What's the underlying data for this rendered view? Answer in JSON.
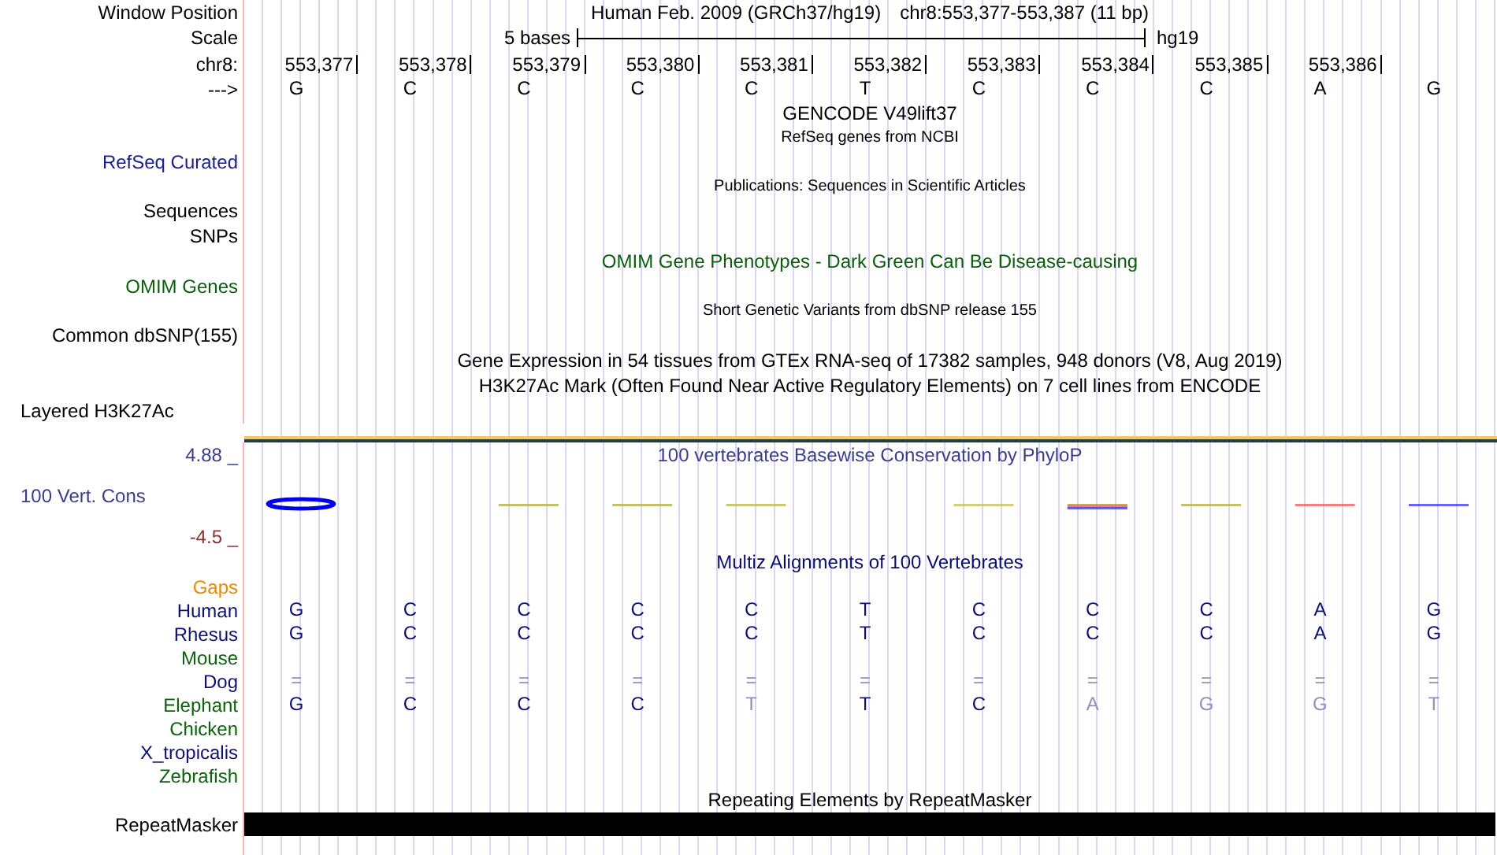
{
  "header": {
    "position_label": "Window Position",
    "assembly_title": "Human Feb. 2009 (GRCh37/hg19)",
    "range_title": "chr8:553,377-553,387 (11 bp)",
    "scale_label": "Scale",
    "scale_text": "5 bases",
    "scale_db": "hg19",
    "chrom_label": "chr8:",
    "positions": [
      "553,377",
      "553,378",
      "553,379",
      "553,380",
      "553,381",
      "553,382",
      "553,383",
      "553,384",
      "553,385",
      "553,386"
    ],
    "strand_label": "--->",
    "bases": [
      "G",
      "C",
      "C",
      "C",
      "C",
      "T",
      "C",
      "C",
      "C",
      "A",
      "G"
    ]
  },
  "tracks": [
    {
      "kind": "title",
      "text": "GENCODE V49lift37",
      "color": "#000000"
    },
    {
      "kind": "subtitle",
      "text": "RefSeq genes from NCBI"
    },
    {
      "kind": "label",
      "label": "RefSeq Curated",
      "color": "#1c1c8c"
    },
    {
      "kind": "subtitle",
      "text": "Publications: Sequences in Scientific Articles"
    },
    {
      "kind": "label",
      "label": "Sequences",
      "color": "#000000"
    },
    {
      "kind": "label",
      "label": "SNPs",
      "color": "#000000"
    },
    {
      "kind": "title",
      "text": "OMIM Gene Phenotypes - Dark Green Can Be Disease-causing",
      "color": "#0b5e0b"
    },
    {
      "kind": "label",
      "label": "OMIM Genes",
      "color": "#0b5e0b"
    },
    {
      "kind": "subtitle",
      "text": "Short Genetic Variants from dbSNP release 155"
    },
    {
      "kind": "label",
      "label": "Common dbSNP(155)",
      "color": "#000000"
    },
    {
      "kind": "title",
      "text": "Gene Expression in 54 tissues from GTEx RNA-seq of 17382 samples, 948 donors (V8, Aug 2019)",
      "color": "#000000"
    },
    {
      "kind": "title",
      "text": "H3K27Ac Mark (Often Found Near Active Regulatory Elements) on 7 cell lines from ENCODE",
      "color": "#000000"
    },
    {
      "kind": "leftlabel",
      "label": "Layered H3K27Ac",
      "color": "#000000"
    },
    {
      "kind": "wiggle",
      "label": "100 Vert. Cons",
      "max": "4.88 _",
      "min": "-4.5 _",
      "text": "100 vertebrates Basewise Conservation by PhyloP",
      "color": "#3c3c8c"
    },
    {
      "kind": "title",
      "text": "Multiz Alignments of 100 Vertebrates",
      "color": "#0c0c6c"
    },
    {
      "kind": "species",
      "label": "Gaps",
      "color": "#e68a00"
    },
    {
      "kind": "species",
      "label": "Human",
      "color": "#101070",
      "bases": [
        {
          "base": "G",
          "match": true
        },
        {
          "base": "C",
          "match": true
        },
        {
          "base": "C",
          "match": true
        },
        {
          "base": "C",
          "match": true
        },
        {
          "base": "C",
          "match": true
        },
        {
          "base": "T",
          "match": true
        },
        {
          "base": "C",
          "match": true
        },
        {
          "base": "C",
          "match": true
        },
        {
          "base": "C",
          "match": true
        },
        {
          "base": "A",
          "match": true
        },
        {
          "base": "G",
          "match": true
        }
      ]
    },
    {
      "kind": "species",
      "label": "Rhesus",
      "color": "#101070",
      "bases": [
        {
          "base": "G",
          "match": true
        },
        {
          "base": "C",
          "match": true
        },
        {
          "base": "C",
          "match": true
        },
        {
          "base": "C",
          "match": true
        },
        {
          "base": "C",
          "match": true
        },
        {
          "base": "T",
          "match": true
        },
        {
          "base": "C",
          "match": true
        },
        {
          "base": "C",
          "match": true
        },
        {
          "base": "C",
          "match": true
        },
        {
          "base": "A",
          "match": true
        },
        {
          "base": "G",
          "match": true
        }
      ]
    },
    {
      "kind": "species",
      "label": "Mouse",
      "color": "#0b640b"
    },
    {
      "kind": "species",
      "label": "Dog",
      "color": "#101070",
      "bases": [
        {
          "base": "=",
          "match": false
        },
        {
          "base": "=",
          "match": false
        },
        {
          "base": "=",
          "match": false
        },
        {
          "base": "=",
          "match": false
        },
        {
          "base": "=",
          "match": false
        },
        {
          "base": "=",
          "match": false
        },
        {
          "base": "=",
          "match": false
        },
        {
          "base": "=",
          "match": false
        },
        {
          "base": "=",
          "match": false
        },
        {
          "base": "=",
          "match": false
        },
        {
          "base": "=",
          "match": false
        }
      ]
    },
    {
      "kind": "species",
      "label": "Elephant",
      "color": "#0b640b",
      "bases": [
        {
          "base": "G",
          "match": true
        },
        {
          "base": "C",
          "match": true
        },
        {
          "base": "C",
          "match": true
        },
        {
          "base": "C",
          "match": true
        },
        {
          "base": "T",
          "match": false
        },
        {
          "base": "T",
          "match": true
        },
        {
          "base": "C",
          "match": true
        },
        {
          "base": "A",
          "match": false
        },
        {
          "base": "G",
          "match": false
        },
        {
          "base": "G",
          "match": false
        },
        {
          "base": "T",
          "match": false
        }
      ]
    },
    {
      "kind": "species",
      "label": "Chicken",
      "color": "#0b640b"
    },
    {
      "kind": "species",
      "label": "X_tropicalis",
      "color": "#101070"
    },
    {
      "kind": "species",
      "label": "Zebrafish",
      "color": "#0b640b"
    },
    {
      "kind": "title",
      "text": "Repeating Elements by RepeatMasker",
      "color": "#000000"
    },
    {
      "kind": "bar",
      "label": "RepeatMasker",
      "color": "#000000"
    }
  ]
}
